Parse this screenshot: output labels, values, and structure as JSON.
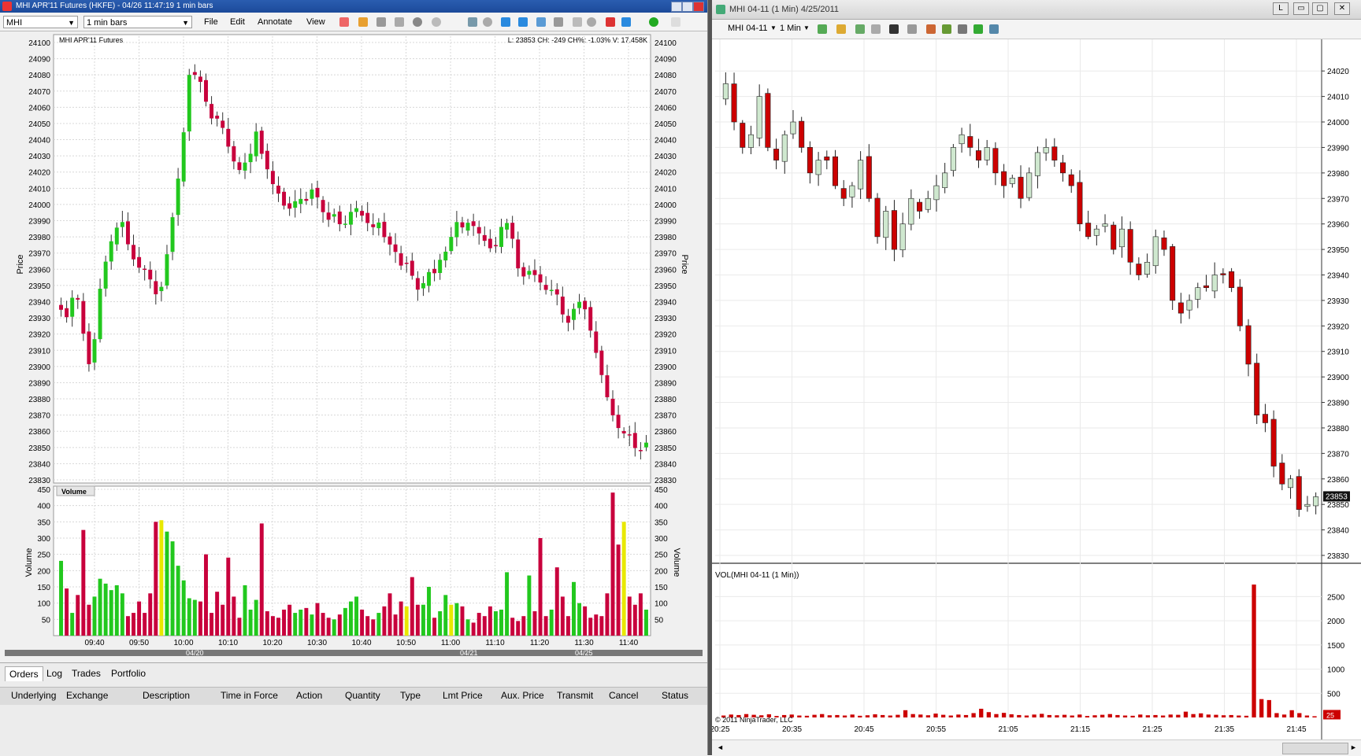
{
  "left_window": {
    "title": "MHI APR'11 Futures (HKFE) - 04/26 11:47:19  1 min bars",
    "symbol": "MHI",
    "bar_size": "1 min bars",
    "menu": [
      "File",
      "Edit",
      "Annotate",
      "View"
    ],
    "chart_label": "MHI APR'11 Futures",
    "info_text": "L: 23853 CH: -249 CH%: -1.03% V: 17.458K",
    "price_axis_label": "Price",
    "volume_axis_label": "Volume",
    "volume_pane_label": "Volume",
    "dates": [
      "04/20",
      "04/21",
      "04/25"
    ],
    "bottom_tabs": [
      "Orders",
      "Log",
      "Trades",
      "Portfolio"
    ],
    "columns": [
      "Underlying",
      "Exchange",
      "Description",
      "Time in Force",
      "Action",
      "Quantity",
      "Type",
      "Lmt Price",
      "Aux. Price",
      "Transmit",
      "Cancel",
      "Status"
    ]
  },
  "right_window": {
    "title": "MHI 04-11 (1 Min)  4/25/2011",
    "instrument": "MHI 04-11",
    "interval": "1 Min",
    "volume_label": "VOL(MHI 04-11 (1 Min))",
    "copyright": "© 2011 NinjaTrader, LLC",
    "last_price": "23853",
    "last_volume": "25"
  },
  "colors": {
    "up": "#22c81e",
    "down": "#c8003c",
    "up_r": "#cfe8cf",
    "down_r": "#cc0000",
    "volume_r": "#cc0000",
    "yellow": "#e8e800"
  },
  "chart_data": [
    {
      "type": "candlestick",
      "title": "MHI APR'11 Futures",
      "ylabel": "Price",
      "ylim": [
        23830,
        24100
      ],
      "y_ticks": [
        24100,
        24090,
        24080,
        24070,
        24060,
        24050,
        24040,
        24030,
        24020,
        24010,
        24000,
        23990,
        23980,
        23970,
        23960,
        23950,
        23940,
        23930,
        23920,
        23910,
        23900,
        23890,
        23880,
        23870,
        23860,
        23850,
        23840,
        23830
      ],
      "x_ticks": [
        "09:40",
        "09:50",
        "10:00",
        "10:10",
        "10:20",
        "10:30",
        "10:40",
        "10:50",
        "11:00",
        "11:10",
        "11:20",
        "11:30",
        "11:40"
      ],
      "path": [
        23935,
        23930,
        23945,
        23940,
        23910,
        23895,
        23940,
        23960,
        23975,
        23985,
        23990,
        23975,
        23965,
        23960,
        23960,
        23950,
        23940,
        23960,
        23985,
        24010,
        24040,
        24080,
        24080,
        24075,
        24060,
        24050,
        24055,
        24040,
        24030,
        24020,
        24025,
        24030,
        24045,
        24030,
        24020,
        24010,
        24005,
        23995,
        24000,
        24005,
        24000,
        24010,
        24005,
        23995,
        23990,
        23995,
        23985,
        23990,
        24000,
        23995,
        23990,
        23985,
        23990,
        23980,
        23975,
        23970,
        23960,
        23965,
        23950,
        23945,
        23960,
        23955,
        23965,
        23970,
        23980,
        23990,
        23985,
        23990,
        23985,
        23980,
        23975,
        23970,
        23985,
        23990,
        23980,
        23960,
        23955,
        23960,
        23955,
        23950,
        23945,
        23950,
        23935,
        23925,
        23935,
        23940,
        23935,
        23920,
        23905,
        23890,
        23875,
        23865,
        23858,
        23860,
        23850,
        23848,
        23853
      ],
      "volume": {
        "ylabel": "Volume",
        "ylim": [
          0,
          450
        ],
        "y_ticks": [
          450,
          400,
          350,
          300,
          250,
          200,
          150,
          100,
          50
        ],
        "values": [
          230,
          145,
          70,
          125,
          325,
          95,
          120,
          175,
          160,
          140,
          155,
          130,
          60,
          70,
          105,
          70,
          130,
          350,
          355,
          320,
          290,
          215,
          170,
          115,
          110,
          105,
          250,
          70,
          135,
          95,
          240,
          120,
          55,
          155,
          80,
          110,
          345,
          75,
          60,
          55,
          80,
          95,
          70,
          80,
          85,
          65,
          100,
          70,
          55,
          50,
          65,
          85,
          105,
          120,
          80,
          60,
          50,
          70,
          90,
          130,
          65,
          105,
          90,
          180,
          95,
          95,
          150,
          55,
          75,
          125,
          95,
          100,
          90,
          50,
          40,
          70,
          60,
          90,
          75,
          80,
          195,
          55,
          45,
          60,
          185,
          75,
          300,
          60,
          80,
          210,
          120,
          60,
          165,
          100,
          90,
          55,
          65,
          60,
          130,
          440,
          280,
          350,
          120,
          95,
          130,
          80
        ]
      }
    },
    {
      "type": "candlestick",
      "title": "MHI 04-11 (1 Min)",
      "ylim": [
        23830,
        24025
      ],
      "y_ticks": [
        24020,
        24010,
        24000,
        23990,
        23980,
        23970,
        23960,
        23950,
        23940,
        23930,
        23920,
        23910,
        23900,
        23890,
        23880,
        23870,
        23860,
        23850,
        23840,
        23830
      ],
      "x_ticks": [
        "20:25",
        "20:35",
        "20:45",
        "20:55",
        "21:05",
        "21:15",
        "21:25",
        "21:35",
        "21:45"
      ],
      "path": [
        24015,
        24000,
        23990,
        23995,
        24010,
        23990,
        23985,
        23995,
        24000,
        23990,
        23980,
        23985,
        23985,
        23975,
        23970,
        23975,
        23985,
        23970,
        23955,
        23965,
        23950,
        23960,
        23970,
        23965,
        23970,
        23975,
        23980,
        23990,
        23995,
        23990,
        23985,
        23990,
        23980,
        23975,
        23978,
        23970,
        23980,
        23988,
        23990,
        23985,
        23980,
        23975,
        23960,
        23955,
        23958,
        23960,
        23950,
        23958,
        23945,
        23940,
        23945,
        23955,
        23950,
        23930,
        23925,
        23930,
        23935,
        23935,
        23940,
        23940,
        23935,
        23920,
        23905,
        23885,
        23882,
        23865,
        23858,
        23860,
        23848,
        23850,
        23853
      ],
      "volume": {
        "label": "VOL(MHI 04-11 (1 Min))",
        "ylim": [
          0,
          2800
        ],
        "y_ticks": [
          2500,
          2000,
          1500,
          1000,
          500
        ],
        "values": [
          40,
          60,
          50,
          70,
          55,
          45,
          65,
          30,
          50,
          60,
          40,
          35,
          55,
          70,
          45,
          50,
          40,
          60,
          35,
          45,
          65,
          50,
          40,
          55,
          150,
          70,
          60,
          45,
          80,
          55,
          40,
          60,
          50,
          90,
          180,
          110,
          70,
          95,
          65,
          50,
          40,
          60,
          75,
          50,
          45,
          55,
          40,
          60,
          30,
          45,
          55,
          70,
          50,
          40,
          35,
          60,
          45,
          50,
          40,
          60,
          55,
          120,
          70,
          85,
          60,
          55,
          45,
          50,
          40,
          35,
          2750,
          380,
          360,
          90,
          60,
          150,
          90,
          40,
          25
        ]
      }
    }
  ]
}
